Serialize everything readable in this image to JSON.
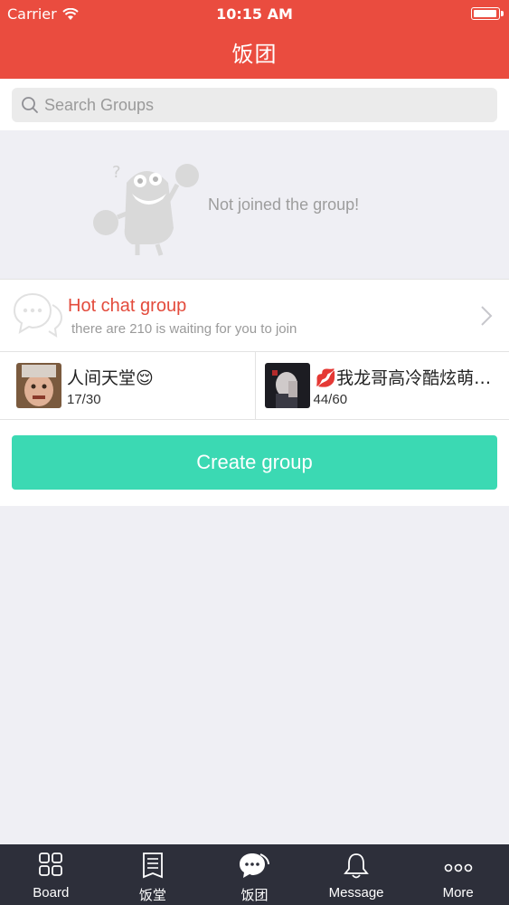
{
  "status_bar": {
    "carrier": "Carrier",
    "time": "10:15 AM",
    "battery_level": 1.0
  },
  "nav": {
    "title": "饭团"
  },
  "search": {
    "placeholder": "Search Groups"
  },
  "empty_state": {
    "text": "Not joined the group!"
  },
  "hot_chat": {
    "title": "Hot chat group",
    "subtitle": "there are 210 is waiting for you to join"
  },
  "groups": [
    {
      "name": "人间天堂😌",
      "count": "17/30"
    },
    {
      "name": "💋我龙哥高冷酷炫萌…",
      "count": "44/60"
    }
  ],
  "create_button": {
    "label": "Create group"
  },
  "tabs": [
    {
      "label": "Board",
      "icon": "grid-icon"
    },
    {
      "label": "饭堂",
      "icon": "document-icon"
    },
    {
      "label": "饭团",
      "icon": "chat-bubble-icon"
    },
    {
      "label": "Message",
      "icon": "bell-icon"
    },
    {
      "label": "More",
      "icon": "more-dots-icon"
    }
  ],
  "colors": {
    "header": "#ea4c3f",
    "accent_green": "#3bd9b3",
    "hot_title": "#e34b3c",
    "tabbar": "#2d2f3a"
  }
}
